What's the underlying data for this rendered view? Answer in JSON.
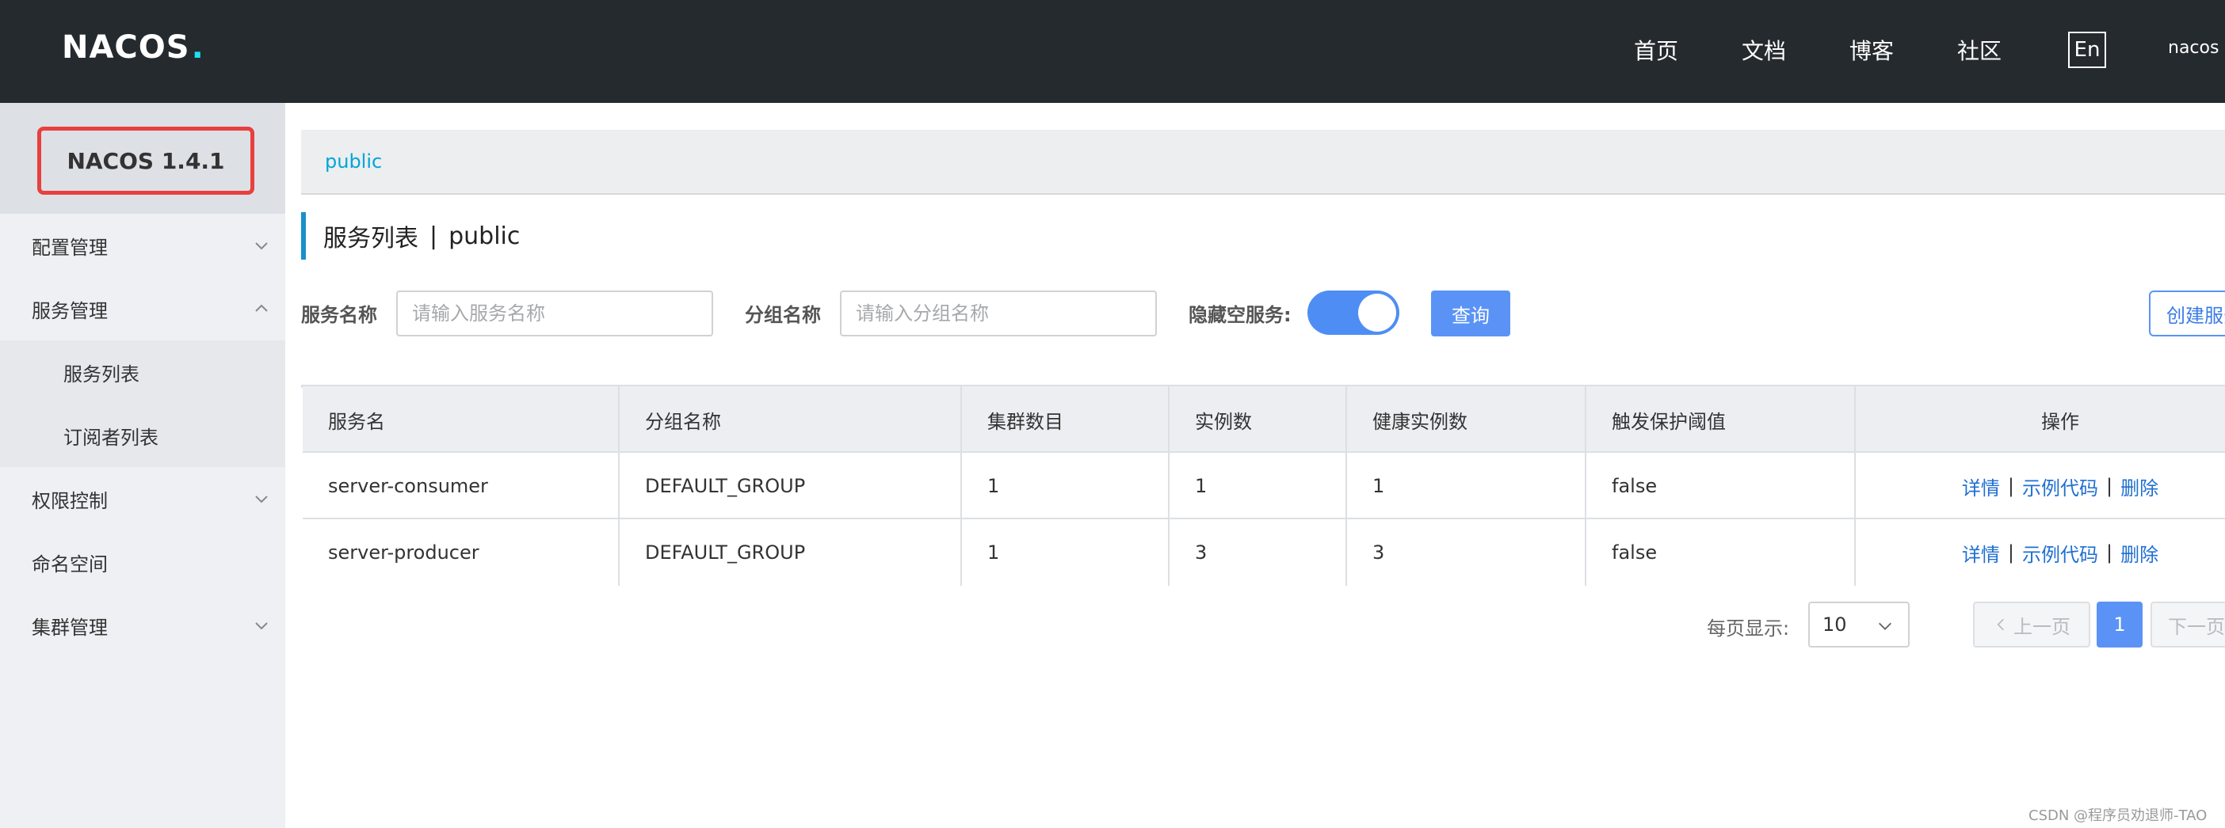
{
  "header": {
    "logo_text": "NACOS",
    "logo_dot": ".",
    "nav": [
      "首页",
      "文档",
      "博客",
      "社区"
    ],
    "lang_button": "En",
    "user": "nacos"
  },
  "sidebar": {
    "version": "NACOS 1.4.1",
    "items": [
      {
        "label": "配置管理"
      },
      {
        "label": "服务管理"
      },
      {
        "label": "服务列表"
      },
      {
        "label": "订阅者列表"
      },
      {
        "label": "权限控制"
      },
      {
        "label": "命名空间"
      },
      {
        "label": "集群管理"
      }
    ]
  },
  "breadcrumb": "public",
  "page": {
    "title_prefix": "服务列表",
    "title_sep": "|",
    "title_ns": "public"
  },
  "filters": {
    "service_label": "服务名称",
    "service_placeholder": "请输入服务名称",
    "group_label": "分组名称",
    "group_placeholder": "请输入分组名称",
    "hide_empty_label": "隐藏空服务:",
    "hide_empty_on": true,
    "query_button": "查询",
    "create_button": "创建服务"
  },
  "table": {
    "columns": [
      "服务名",
      "分组名称",
      "集群数目",
      "实例数",
      "健康实例数",
      "触发保护阈值",
      "操作"
    ],
    "rows": [
      [
        "server-consumer",
        "DEFAULT_GROUP",
        "1",
        "1",
        "1",
        "false"
      ],
      [
        "server-producer",
        "DEFAULT_GROUP",
        "1",
        "3",
        "3",
        "false"
      ]
    ],
    "actions": {
      "detail": "详情",
      "sample_code": "示例代码",
      "delete": "删除",
      "sep": "|"
    }
  },
  "pagination": {
    "page_size_label": "每页显示:",
    "page_size": "10",
    "prev": "上一页",
    "current": "1",
    "next": "下一页"
  },
  "watermark": "CSDN @程序员劝退师-TAO",
  "colors": {
    "accent": "#5a93f5",
    "header_bg": "#252a2f",
    "highlight_border": "#e8403e"
  }
}
